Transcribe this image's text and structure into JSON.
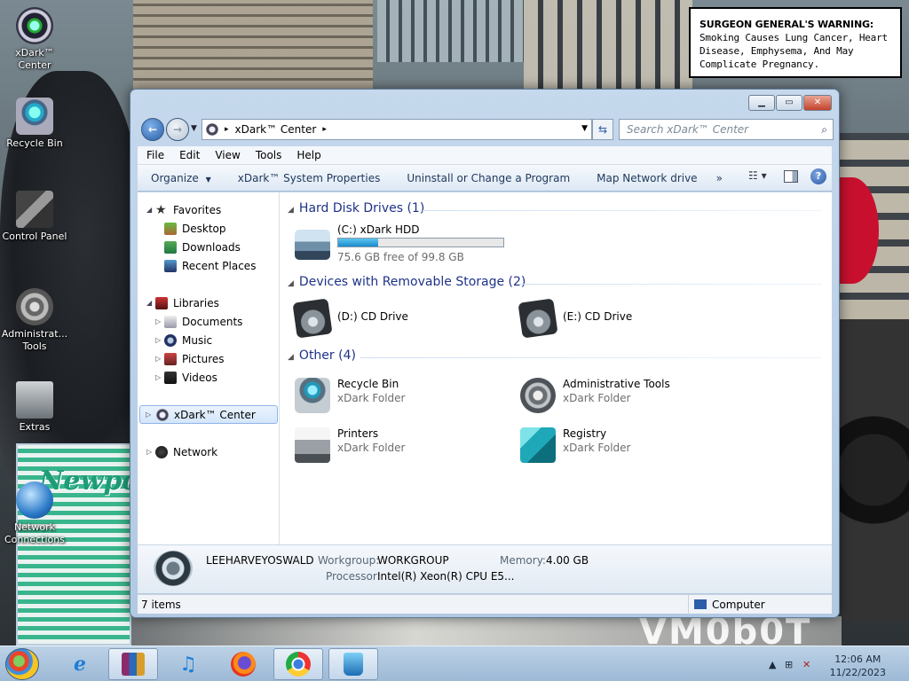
{
  "warning": {
    "heading": "SURGEON GENERAL'S WARNING:",
    "text": "Smoking Causes Lung Cancer, Heart Disease, Emphysema, And May Complicate Pregnancy."
  },
  "desktop": {
    "icons": [
      {
        "label": "xDark™ Center"
      },
      {
        "label": "Recycle Bin"
      },
      {
        "label": "Control Panel"
      },
      {
        "label": "Administrat... Tools"
      },
      {
        "label": "Extras"
      },
      {
        "label": "Network Connections"
      }
    ],
    "background_text": {
      "pack_brand": "Newport",
      "billboard": "VM0b0T"
    }
  },
  "window": {
    "address": {
      "root_icon": "xdark-center-icon",
      "path": "xDark™ Center"
    },
    "search_placeholder": "Search xDark™ Center",
    "menus": [
      "File",
      "Edit",
      "View",
      "Tools",
      "Help"
    ],
    "commands": {
      "organize": "Organize",
      "system_properties": "xDark™ System Properties",
      "uninstall": "Uninstall or Change a Program",
      "map_drive": "Map Network drive",
      "more": "»"
    },
    "nav": {
      "favorites": "Favorites",
      "desktop": "Desktop",
      "downloads": "Downloads",
      "recent": "Recent Places",
      "libraries": "Libraries",
      "documents": "Documents",
      "music": "Music",
      "pictures": "Pictures",
      "videos": "Videos",
      "xdark": "xDark™ Center",
      "network": "Network"
    },
    "groups": {
      "hdd": "Hard Disk Drives (1)",
      "removable": "Devices with Removable Storage (2)",
      "other": "Other (4)"
    },
    "drives": {
      "c": {
        "name": "(C:) xDark HDD",
        "free": "75.6 GB free of 99.8 GB",
        "used_fraction": 0.242
      },
      "d": {
        "name": "(D:) CD Drive"
      },
      "e": {
        "name": "(E:) CD Drive"
      }
    },
    "other_items": {
      "recycle": {
        "name": "Recycle Bin",
        "type": "xDark Folder"
      },
      "admin": {
        "name": "Administrative Tools",
        "type": "xDark Folder"
      },
      "printers": {
        "name": "Printers",
        "type": "xDark Folder"
      },
      "registry": {
        "name": "Registry",
        "type": "xDark Folder"
      }
    },
    "details": {
      "computer_name": "LEEHARVEYOSWALD",
      "workgroup_label": "Workgroup:",
      "workgroup": "WORKGROUP",
      "memory_label": "Memory:",
      "memory": "4.00 GB",
      "processor_label": "Processor:",
      "processor": "Intel(R) Xeon(R) CPU E5..."
    },
    "status": {
      "items": "7 items",
      "zone": "Computer"
    }
  },
  "taskbar": {
    "time": "12:06 AM",
    "date": "11/22/2023"
  },
  "colors": {
    "accent": "#1e3287",
    "bar_fill": "#1c8bcd",
    "window_frame": "#b2c9e2"
  }
}
